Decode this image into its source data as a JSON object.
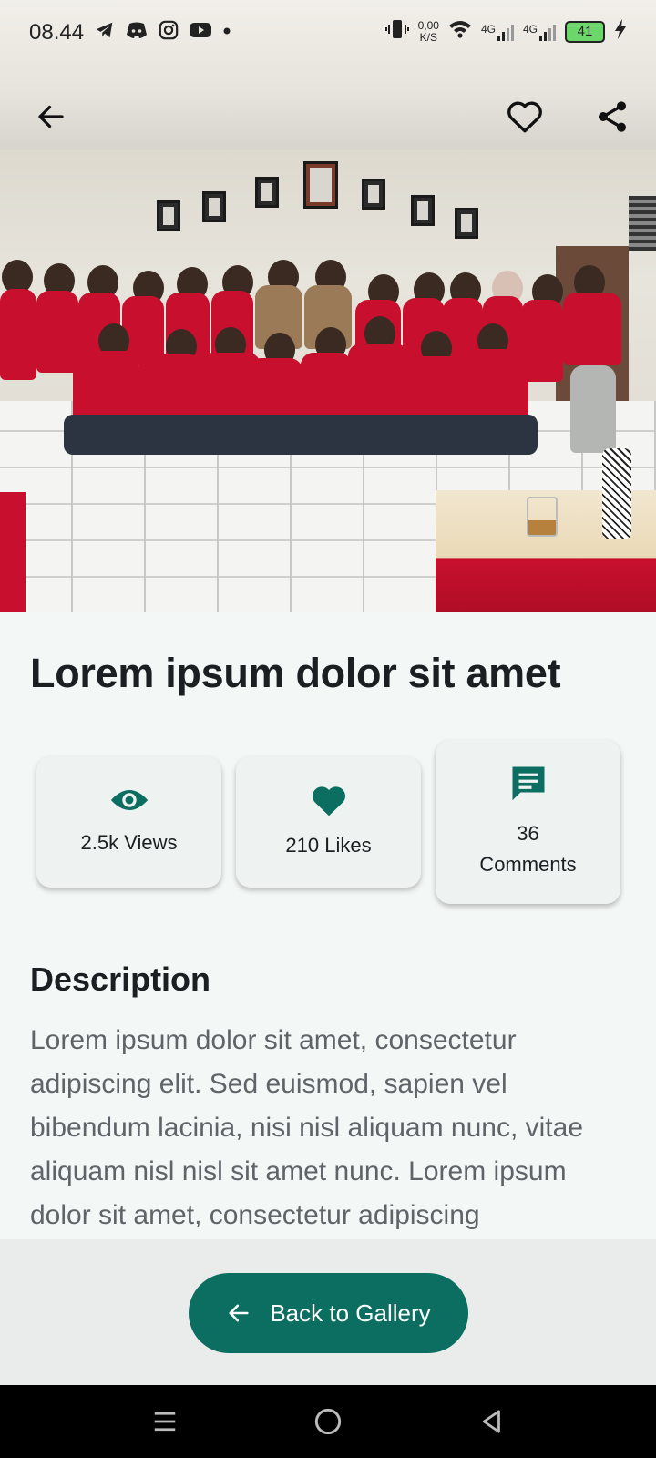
{
  "status_bar": {
    "time": "08.44",
    "left_icons": [
      "telegram-icon",
      "discord-icon",
      "instagram-icon",
      "youtube-icon",
      "dot-icon"
    ],
    "net_speed_value": "0,00",
    "net_speed_unit": "K/S",
    "network_1": "4G",
    "network_2": "4G",
    "battery": "41"
  },
  "header": {
    "back_icon": "arrow-left-icon",
    "favorite_icon": "heart-outline-icon",
    "share_icon": "share-icon"
  },
  "article": {
    "title": "Lorem ipsum dolor sit amet",
    "stats": {
      "views": "2.5k Views",
      "likes": "210 Likes",
      "comments_count": "36",
      "comments_label": "Comments"
    },
    "description_heading": "Description",
    "description": "Lorem ipsum dolor sit amet, consectetur adipiscing elit. Sed euismod, sapien vel bibendum lacinia, nisi nisl aliquam nunc, vitae aliquam nisl nisl sit amet nunc. Lorem ipsum dolor sit amet, consectetur adipiscing"
  },
  "footer": {
    "back_button_label": "Back to Gallery"
  },
  "colors": {
    "accent": "#0b6e61",
    "background": "#f3f7f6",
    "text_primary": "#1b1f22",
    "text_secondary": "#5f6468"
  }
}
